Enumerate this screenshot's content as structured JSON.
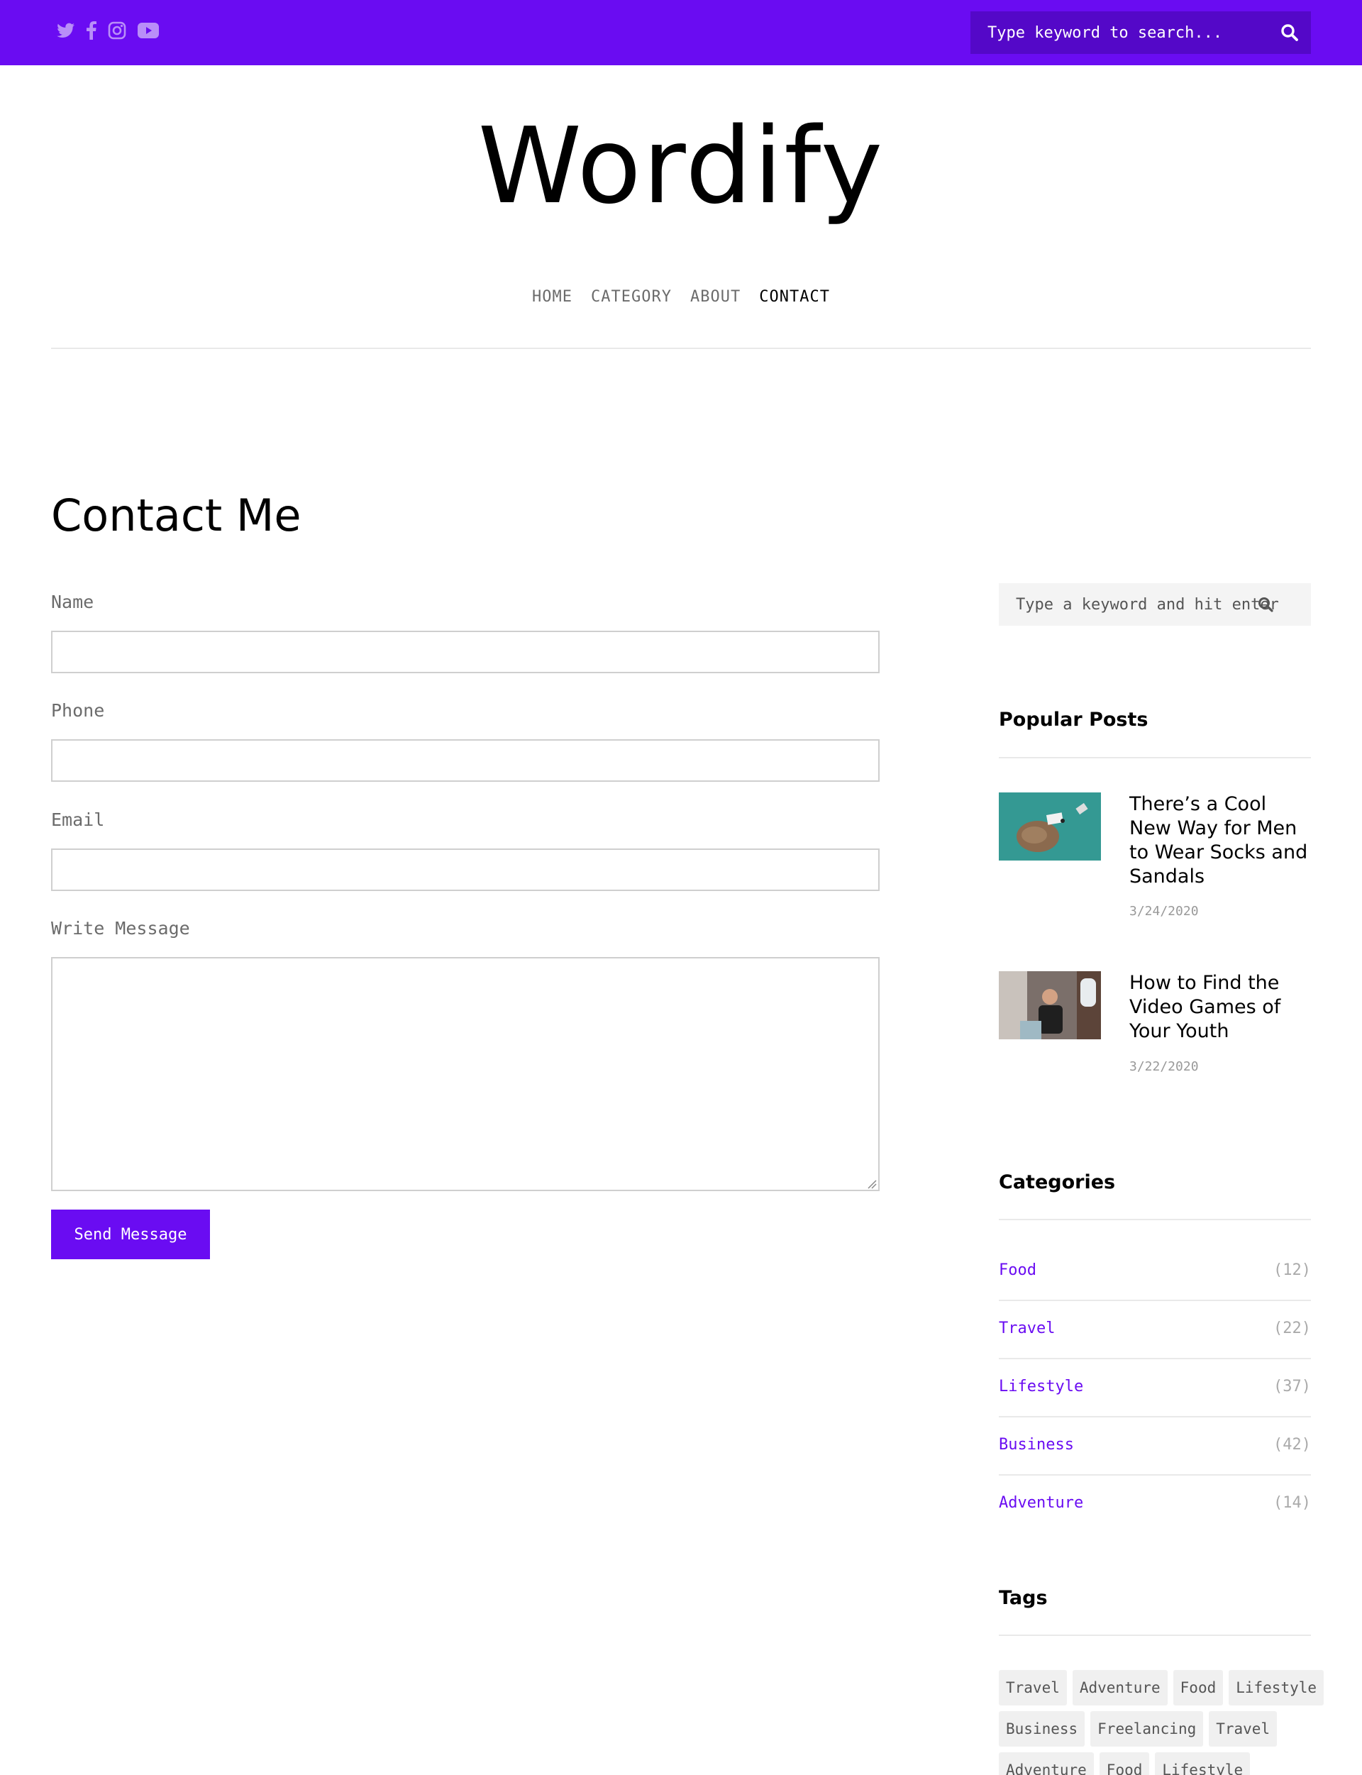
{
  "topbar": {
    "social": [
      {
        "icon": "twitter-icon"
      },
      {
        "icon": "facebook-icon"
      },
      {
        "icon": "instagram-icon"
      },
      {
        "icon": "youtube-icon"
      }
    ],
    "search": {
      "placeholder": "Type keyword to search..."
    }
  },
  "header": {
    "logo": "Wordify",
    "nav": [
      "HOME",
      "CATEGORY",
      "ABOUT",
      "CONTACT"
    ],
    "active_nav": "CONTACT"
  },
  "main": {
    "title": "Contact Me",
    "form": {
      "name_label": "Name",
      "name_value": "",
      "phone_label": "Phone",
      "phone_value": "",
      "email_label": "Email",
      "email_value": "",
      "message_label": "Write Message",
      "message_value": "",
      "submit_label": "Send Message"
    }
  },
  "sidebar": {
    "search": {
      "placeholder": "Type a keyword and hit enter"
    },
    "popular": {
      "title": "Popular Posts",
      "posts": [
        {
          "title": "There’s a Cool New Way for Men to Wear Socks and Sandals",
          "date": "3/24/2020"
        },
        {
          "title": "How to Find the Video Games of Your Youth",
          "date": "3/22/2020"
        }
      ]
    },
    "categories": {
      "title": "Categories",
      "items": [
        {
          "name": "Food",
          "count": "(12)"
        },
        {
          "name": "Travel",
          "count": "(22)"
        },
        {
          "name": "Lifestyle",
          "count": "(37)"
        },
        {
          "name": "Business",
          "count": "(42)"
        },
        {
          "name": "Adventure",
          "count": "(14)"
        }
      ]
    },
    "tags": {
      "title": "Tags",
      "items": [
        "Travel",
        "Adventure",
        "Food",
        "Lifestyle",
        "Business",
        "Freelancing",
        "Travel",
        "Adventure",
        "Food",
        "Lifestyle"
      ]
    }
  },
  "colors": {
    "accent": "#6a0cf2",
    "top_search_bg": "#5408c8",
    "category_link": "#6a0cf2"
  }
}
